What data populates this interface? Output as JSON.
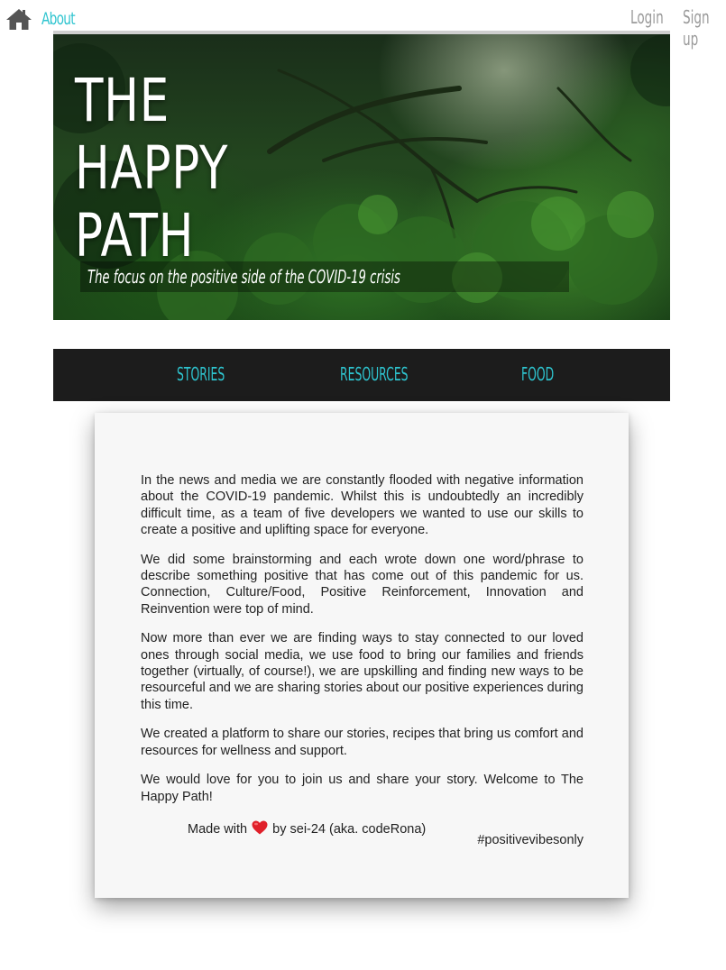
{
  "nav": {
    "about_label": "About",
    "login_label": "Login",
    "signup_label": "Sign up",
    "home_icon": "home-icon"
  },
  "hero": {
    "title_lines": [
      "THE",
      "HAPPY",
      "PATH"
    ],
    "tagline": "The focus on the positive side of the COVID-19 crisis"
  },
  "categories": [
    "STORIES",
    "RESOURCES",
    "FOOD"
  ],
  "about": {
    "paragraphs": [
      "In the news and media we are constantly flooded with negative information about the COVID-19 pandemic. Whilst this is undoubtedly an incredibly difficult time, as a team of five developers we wanted to use our skills to create a positive and uplifting space for everyone.",
      "We did some brainstorming and each wrote down one word/phrase to describe something positive that has come out of this pandemic for us. Connection, Culture/Food, Positive Reinforcement, Innovation and Reinvention were top of mind.",
      "Now more than ever we are finding ways to stay connected to our loved ones through social media, we use food to bring our families and friends together (virtually, of course!), we are upskilling and finding new ways to be resourceful and we are sharing stories about our positive experiences during this time.",
      "We created a platform to share our stories, recipes that bring us comfort and resources for wellness and support.",
      "We would love for you to join us and share your story. Welcome to The Happy Path!"
    ],
    "credit_prefix": "Made with",
    "credit_suffix": "by sei-24 (aka. codeRona)",
    "hashtag": "#positivevibesonly"
  },
  "colors": {
    "accent": "#2ec4cf",
    "nav_dark": "#1c1c1c",
    "heart": "#e0202a",
    "muted_link": "#9a9a9a"
  }
}
